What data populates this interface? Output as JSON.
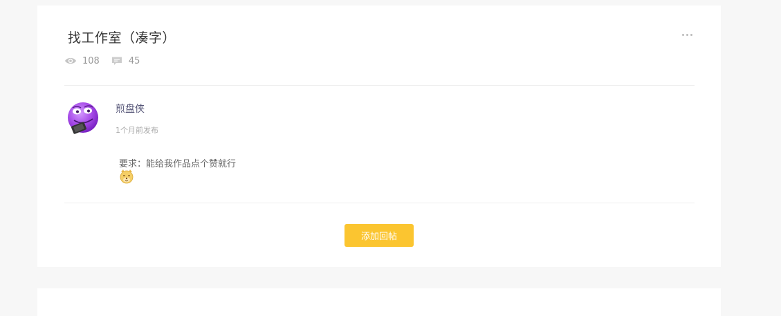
{
  "thread": {
    "title": "找工作室（凑字）",
    "views": "108",
    "comments": "45",
    "more_icon": "ellipsis-icon"
  },
  "post": {
    "author": "煎盘侠",
    "time": "1个月前发布",
    "content": "要求：能给我作品点个赞就行",
    "avatar_icon": "purple-smiley-avatar",
    "emoji_icon": "doge-emoji-icon"
  },
  "actions": {
    "reply_label": "添加回帖"
  },
  "colors": {
    "accent": "#fbc530",
    "background": "#f7f7f7",
    "card": "#ffffff"
  }
}
